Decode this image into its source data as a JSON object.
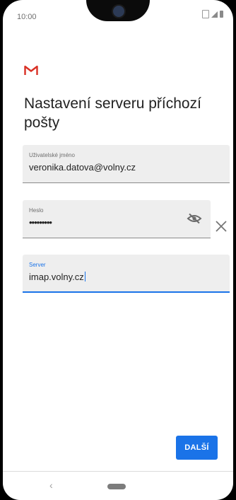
{
  "status_bar": {
    "time": "10:00",
    "icons": [
      "vibrate-icon",
      "signal-icon",
      "battery-icon"
    ]
  },
  "app": {
    "logo_icon": "gmail-icon",
    "title": "Nastavení serveru příchozí pošty"
  },
  "form": {
    "username": {
      "label": "Uživatelské jméno",
      "value": "veronika.datova@volny.cz"
    },
    "password": {
      "label": "Heslo",
      "value": "•••••••••",
      "toggle_icon": "visibility-off-icon",
      "clear_icon": "close-icon"
    },
    "server": {
      "label": "Server",
      "value": "imap.volny.cz"
    }
  },
  "actions": {
    "next_label": "DALŠÍ"
  },
  "nav_bar": {
    "back_icon": "back-icon",
    "home_icon": "home-pill-icon",
    "back_glyph": "‹"
  },
  "colors": {
    "accent": "#1a73e8",
    "gmail_red": "#d93025",
    "field_bg": "#eeeeee"
  }
}
